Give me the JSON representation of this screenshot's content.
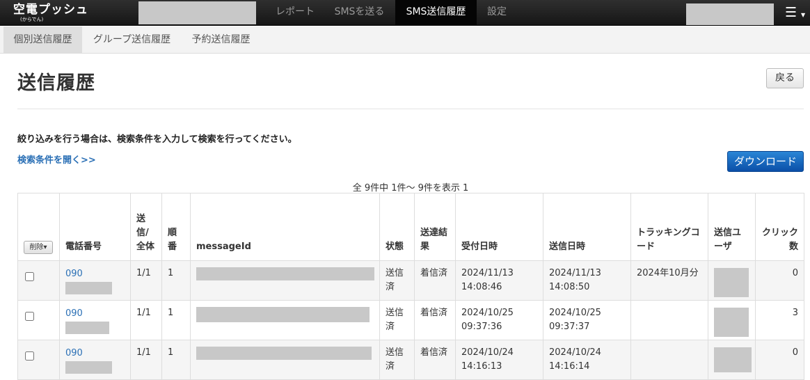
{
  "app": {
    "logo_main": "空電プッシュ",
    "logo_sub": "(からでん)"
  },
  "nav": {
    "items": [
      {
        "label": "レポート"
      },
      {
        "label": "SMSを送る"
      },
      {
        "label": "SMS送信履歴",
        "active": true
      },
      {
        "label": "設定"
      }
    ],
    "menu_icon": "hamburger-menu-icon"
  },
  "subnav": {
    "tabs": [
      {
        "label": "個別送信履歴",
        "active": true
      },
      {
        "label": "グループ送信履歴"
      },
      {
        "label": "予約送信履歴"
      }
    ]
  },
  "page": {
    "title": "送信履歴",
    "back_label": "戻る",
    "instruction": "絞り込みを行う場合は、検索条件を入力して検索を行ってください。",
    "open_search_link": "検索条件を開く>>",
    "download_label": "ダウンロード",
    "result_summary": "全 9件中  1件～ 9件を表示  1"
  },
  "table": {
    "delete_label": "削除▾",
    "headers": {
      "phone": "電話番号",
      "sent_total": "送信/全体",
      "order": "順番",
      "message_id": "messageId",
      "status": "状態",
      "delivery": "送達結果",
      "received": "受付日時",
      "sent": "送信日時",
      "tracking": "トラッキングコード",
      "user": "送信ユーザ",
      "clicks": "クリック数"
    },
    "rows": [
      {
        "phone_prefix": "090",
        "sent_total": "1/1",
        "order": "1",
        "status": "送信済",
        "delivery": "着信済",
        "received_date": "2024/11/13",
        "received_time": "14:08:46",
        "sent_date": "2024/11/13",
        "sent_time": "14:08:50",
        "tracking": "2024年10月分",
        "clicks": "0"
      },
      {
        "phone_prefix": "090",
        "sent_total": "1/1",
        "order": "1",
        "status": "送信済",
        "delivery": "着信済",
        "received_date": "2024/10/25",
        "received_time": "09:37:36",
        "sent_date": "2024/10/25",
        "sent_time": "09:37:37",
        "tracking": "",
        "clicks": "3"
      },
      {
        "phone_prefix": "090",
        "sent_total": "1/1",
        "order": "1",
        "status": "送信済",
        "delivery": "着信済",
        "received_date": "2024/10/24",
        "received_time": "14:16:13",
        "sent_date": "2024/10/24",
        "sent_time": "14:16:14",
        "tracking": "",
        "clicks": "0"
      }
    ]
  },
  "colors": {
    "accent_blue": "#2a6fb5",
    "topbar": "#1c1c1c",
    "download_button": "#1466c0"
  }
}
